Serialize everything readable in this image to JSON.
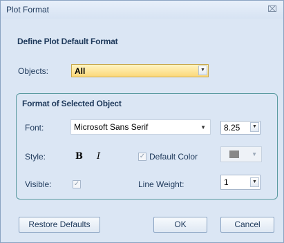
{
  "window": {
    "title": "Plot Format",
    "close_glyph": "⌧"
  },
  "section": {
    "heading": "Define Plot Default Format"
  },
  "objects": {
    "label": "Objects:",
    "selected": "All"
  },
  "group": {
    "title": "Format of Selected Object",
    "font": {
      "label": "Font:",
      "name": "Microsoft Sans Serif",
      "size": "8.25"
    },
    "style": {
      "label": "Style:",
      "bold_glyph": "B",
      "italic_glyph": "I",
      "default_color_label": "Default Color",
      "default_color_checked": true
    },
    "visible": {
      "label": "Visible:",
      "checked": true
    },
    "line_weight": {
      "label": "Line Weight:",
      "value": "1"
    }
  },
  "buttons": {
    "restore": "Restore Defaults",
    "ok": "OK",
    "cancel": "Cancel"
  },
  "glyphs": {
    "check": "✓",
    "arrow": "▼"
  },
  "colors": {
    "objects_highlight": "#fbd87a",
    "swatch": "#888888",
    "group_border": "#5a9aa0"
  }
}
